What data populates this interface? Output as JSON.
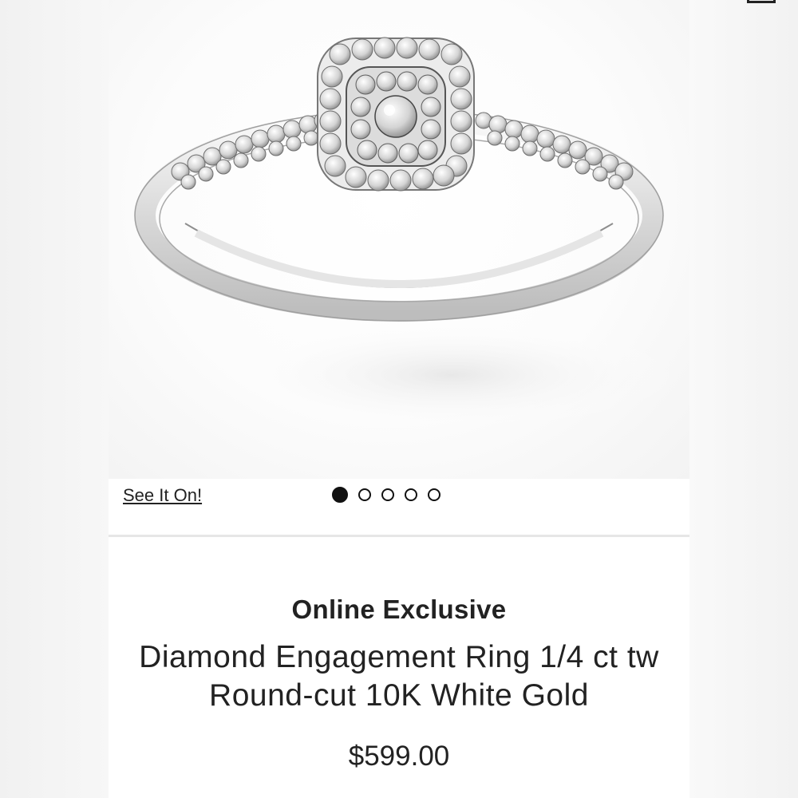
{
  "gallery": {
    "image_alt": "Diamond Engagement Ring 1/4 ct tw Round-cut 10K White Gold",
    "see_it_on_label": "See It On!",
    "dots_total": 5,
    "active_dot": 0
  },
  "product": {
    "badge": "Online Exclusive",
    "title_line1": "Diamond Engagement Ring 1/4 ct tw",
    "title_line2": "Round-cut 10K White Gold",
    "price": "$599.00"
  },
  "colors": {
    "text": "#222222",
    "dot_active": "#111111",
    "background": "#ffffff"
  },
  "icons": {
    "corner": "top-edge-partial-icon"
  }
}
